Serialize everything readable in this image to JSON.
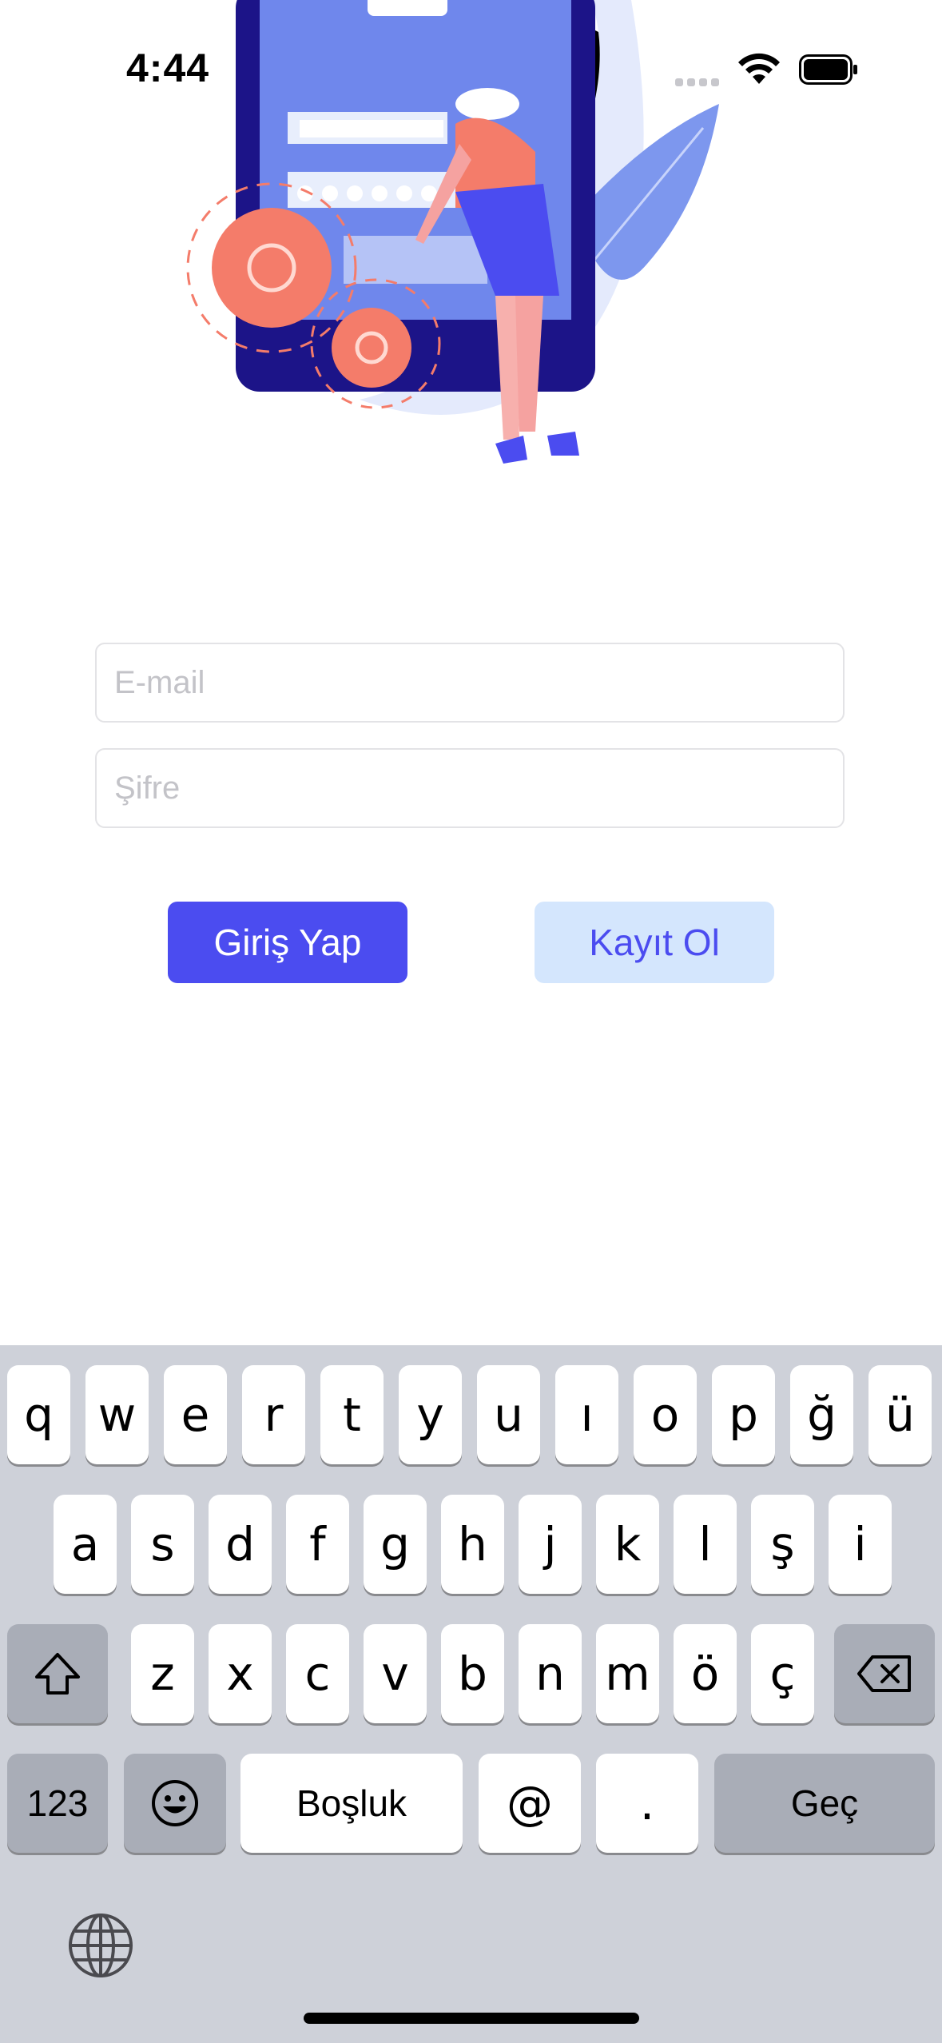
{
  "status_bar": {
    "time": "4:44"
  },
  "form": {
    "email_placeholder": "E-mail",
    "password_placeholder": "Şifre",
    "login_label": "Giriş Yap",
    "register_label": "Kayıt Ol"
  },
  "keyboard": {
    "row1": [
      "q",
      "w",
      "e",
      "r",
      "t",
      "y",
      "u",
      "ı",
      "o",
      "p",
      "ğ",
      "ü"
    ],
    "row2": [
      "a",
      "s",
      "d",
      "f",
      "g",
      "h",
      "j",
      "k",
      "l",
      "ş",
      "i"
    ],
    "row3": [
      "z",
      "x",
      "c",
      "v",
      "b",
      "n",
      "m",
      "ö",
      "ç"
    ],
    "numbers_label": "123",
    "space_label": "Boşluk",
    "at_label": "@",
    "dot_label": ".",
    "go_label": "Geç"
  },
  "colors": {
    "primary": "#4b4cf0",
    "secondary_bg": "#d4e6fd",
    "keyboard_bg": "#ced1d9"
  }
}
